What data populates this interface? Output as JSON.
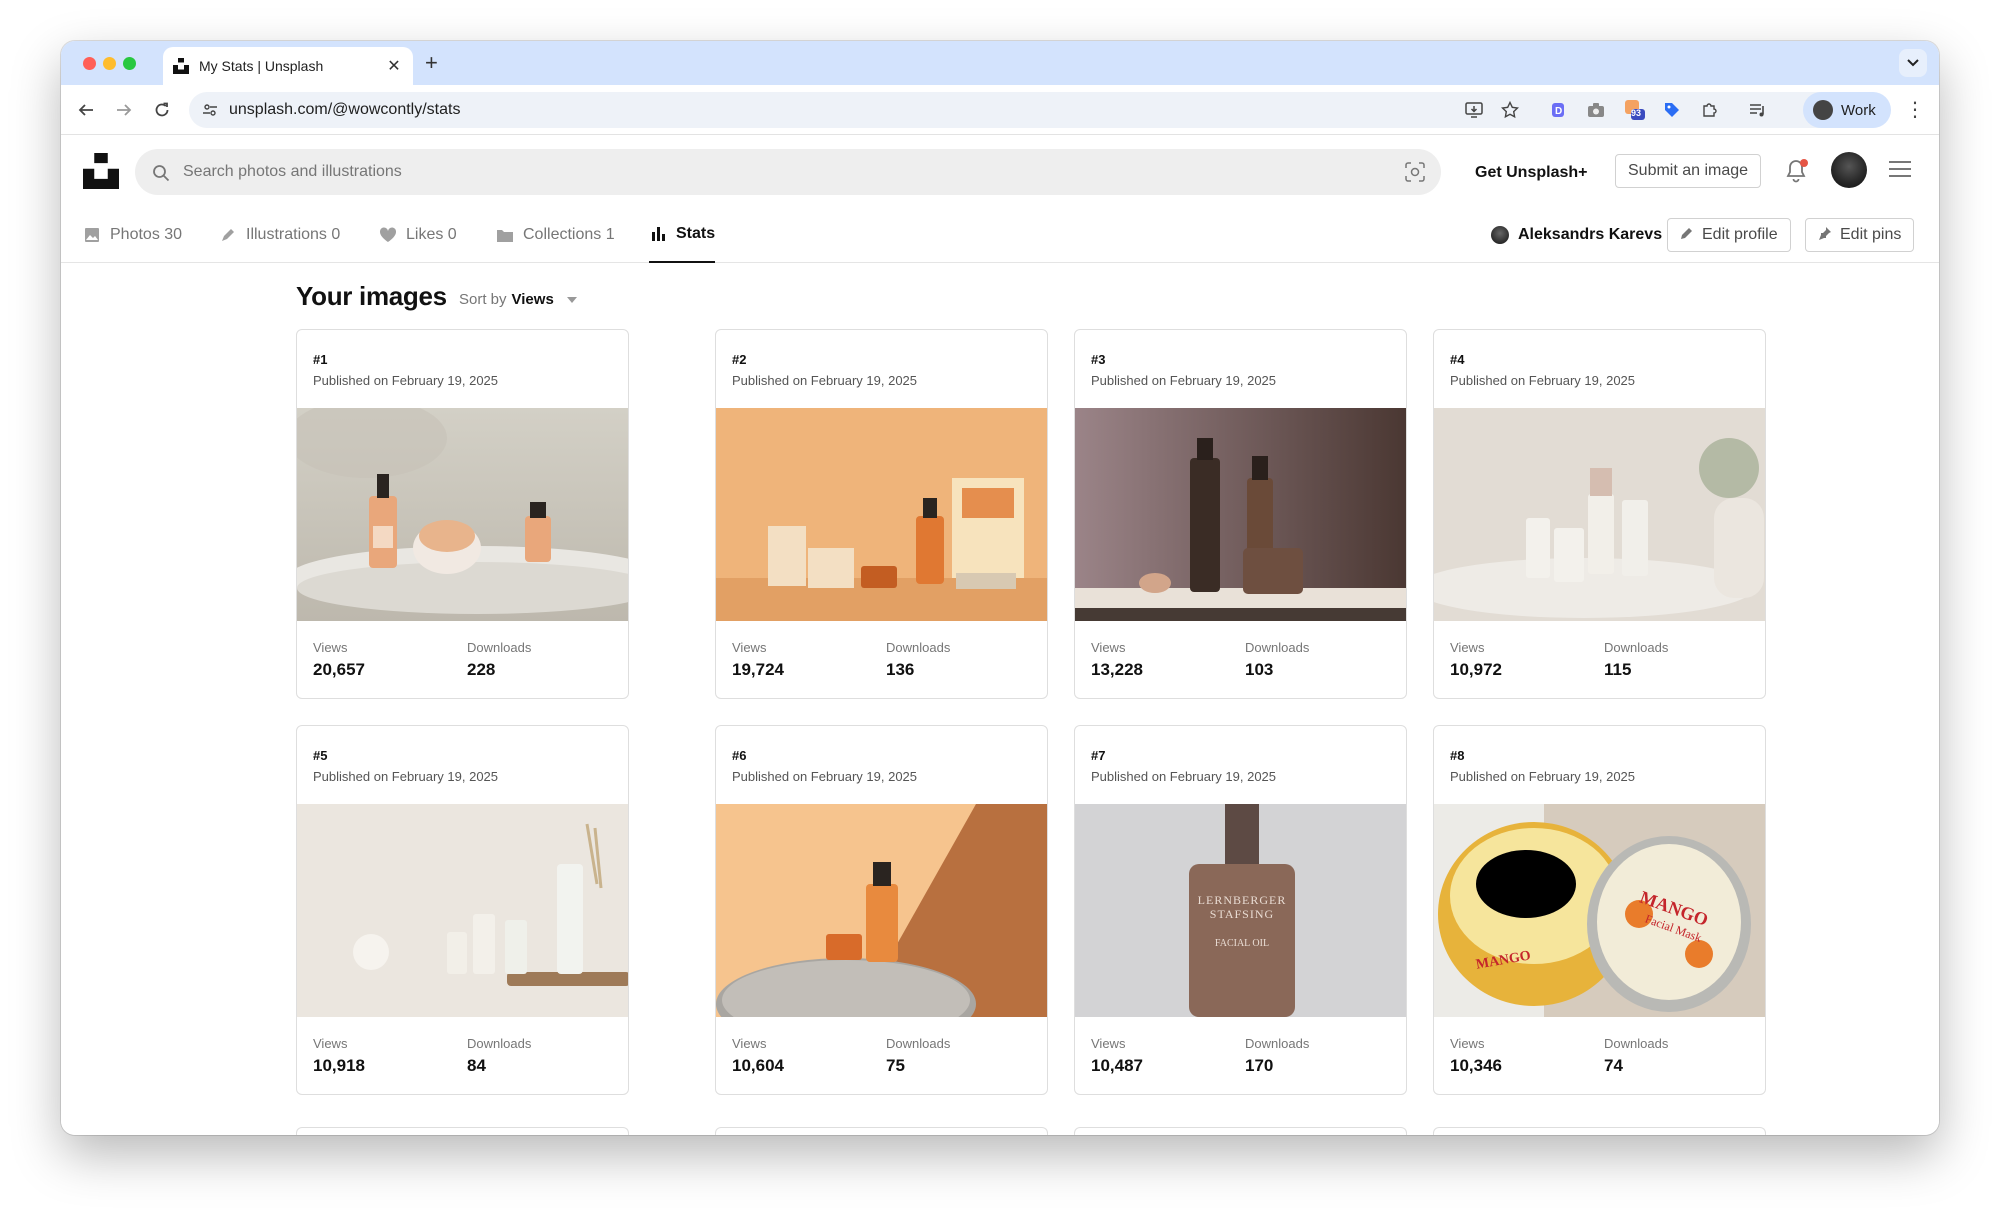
{
  "browser": {
    "tab_title": "My Stats | Unsplash",
    "new_tab_symbol": "+",
    "url": "unsplash.com/@wowcontly/stats",
    "profile_label": "Work",
    "ext_badge": "93"
  },
  "header": {
    "search_placeholder": "Search photos and illustrations",
    "get_plus": "Get Unsplash+",
    "submit_label": "Submit an image"
  },
  "profile_tabs": [
    {
      "label": "Photos 30",
      "icon": "photo-icon"
    },
    {
      "label": "Illustrations 0",
      "icon": "pen-icon"
    },
    {
      "label": "Likes 0",
      "icon": "heart-icon"
    },
    {
      "label": "Collections 1",
      "icon": "folder-icon"
    },
    {
      "label": "Stats",
      "icon": "bar-chart-icon",
      "active": true
    }
  ],
  "owner": {
    "name": "Aleksandrs Karevs",
    "edit_profile": "Edit profile",
    "edit_pins": "Edit pins"
  },
  "main": {
    "heading": "Your images",
    "sort_prefix": "Sort by",
    "sort_value": "Views",
    "stat_labels": {
      "views": "Views",
      "downloads": "Downloads"
    }
  },
  "images": [
    {
      "rank": "#1",
      "published": "Published on February 19, 2025",
      "views": "20,657",
      "downloads": "228"
    },
    {
      "rank": "#2",
      "published": "Published on February 19, 2025",
      "views": "19,724",
      "downloads": "136"
    },
    {
      "rank": "#3",
      "published": "Published on February 19, 2025",
      "views": "13,228",
      "downloads": "103"
    },
    {
      "rank": "#4",
      "published": "Published on February 19, 2025",
      "views": "10,972",
      "downloads": "115"
    },
    {
      "rank": "#5",
      "published": "Published on February 19, 2025",
      "views": "10,918",
      "downloads": "84"
    },
    {
      "rank": "#6",
      "published": "Published on February 19, 2025",
      "views": "10,604",
      "downloads": "75"
    },
    {
      "rank": "#7",
      "published": "Published on February 19, 2025",
      "views": "10,487",
      "downloads": "170"
    },
    {
      "rank": "#8",
      "published": "Published on February 19, 2025",
      "views": "10,346",
      "downloads": "74"
    }
  ],
  "image_text": {
    "img7_line1": "LERNBERGER",
    "img7_line2": "STAFSING",
    "img7_line3": "FACIAL OIL",
    "img8_line1": "MANGO",
    "img8_line2": "Facial Mask",
    "img8_line3": "MANGO"
  }
}
